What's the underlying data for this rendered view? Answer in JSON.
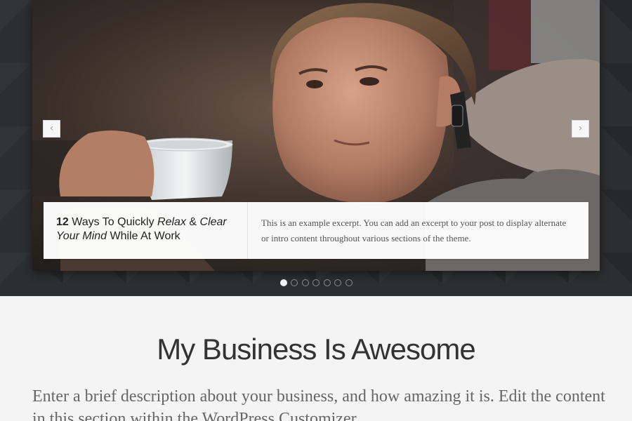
{
  "slider": {
    "prev_arrow": "‹",
    "next_arrow": "›",
    "caption": {
      "title_parts": {
        "number": "12",
        "text1": " Ways To Quickly ",
        "italic1": "Relax",
        "text2": " & ",
        "italic2": "Clear Your Mind",
        "text3": " While At Work"
      },
      "excerpt": "This is an example excerpt. You can add an excerpt to your post to display alternate or intro content throughout various sections of the theme."
    },
    "slide_count": 7,
    "active_slide": 1
  },
  "section": {
    "headline": "My Business Is Awesome",
    "description": "Enter a brief description about your business, and how amazing it is. Edit the content in this section within the WordPress Customizer."
  },
  "colors": {
    "hero_background": "#2c2e31",
    "section_background": "#f4f4f4",
    "caption_background": "#ffffff"
  }
}
